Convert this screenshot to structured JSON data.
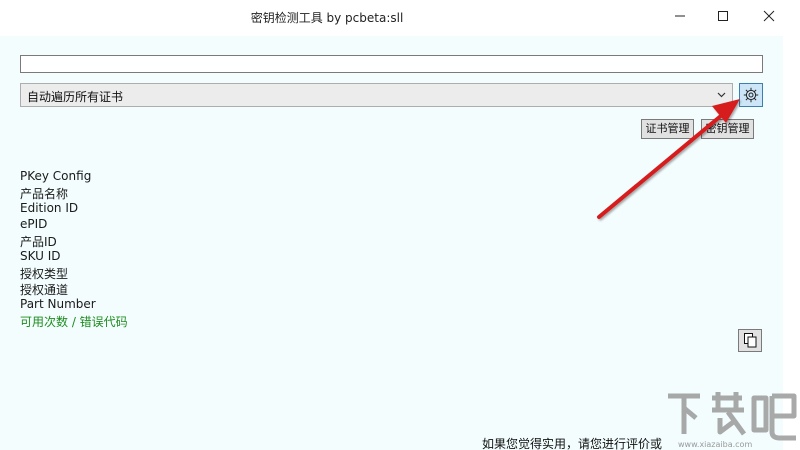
{
  "window": {
    "title": "密钥检测工具 by pcbeta:sll",
    "controls": [
      "minimize-icon",
      "maximize-icon",
      "close-icon"
    ]
  },
  "key_input": {
    "value": ""
  },
  "cert_select": {
    "selected": "自动遍历所有证书"
  },
  "buttons": {
    "cert_manage": "证书管理",
    "key_manage": "密钥管理"
  },
  "info": {
    "lines": [
      "PKey Config",
      "产品名称",
      "Edition ID",
      "ePID",
      "产品ID",
      "SKU ID",
      "授权类型",
      "授权通道",
      "Part Number",
      "可用次数 / 错误代码"
    ]
  },
  "footer": {
    "text": "如果您觉得实用，请您进行评价或"
  },
  "watermark": {
    "text": "下载吧",
    "url": "www.xiazaiba.com"
  },
  "colors": {
    "client_bg": "#f3fdfe",
    "status_green": "#1e8c1e",
    "annotation_arrow": "#d61e1e",
    "gear_button_bg": "#cde6f7"
  }
}
